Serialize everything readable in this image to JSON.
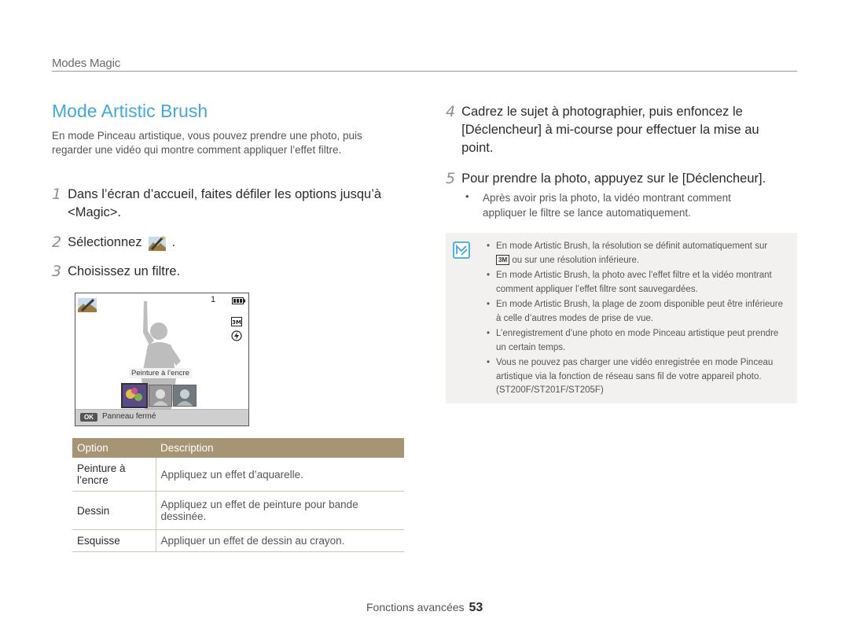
{
  "section": "Modes Magic",
  "title": "Mode Artistic Brush",
  "intro": "En mode Pinceau artistique, vous pouvez prendre une photo, puis regarder une vidéo qui montre comment appliquer l’effet filtre.",
  "steps_left": [
    {
      "num": "1",
      "text": "Dans l’écran d’accueil, faites défiler les options jusqu’à <Magic>."
    },
    {
      "num": "2",
      "text": "Sélectionnez",
      "suffix": "."
    },
    {
      "num": "3",
      "text": "Choisissez un filtre."
    }
  ],
  "screen": {
    "shot_count": "1",
    "filter_caption": "Peinture à l’encre",
    "ok_label": "OK",
    "panel_text": "Panneau fermé",
    "res_label": "3M"
  },
  "table": {
    "headers": [
      "Option",
      "Description"
    ],
    "rows": [
      {
        "option": "Peinture à l’encre",
        "desc": "Appliquez un effet d’aquarelle."
      },
      {
        "option": "Dessin",
        "desc": "Appliquez un effet de peinture pour bande dessinée."
      },
      {
        "option": "Esquisse",
        "desc": "Appliquer un effet de dessin au crayon."
      }
    ]
  },
  "steps_right": [
    {
      "num": "4",
      "pre": "Cadrez le sujet à photographier, puis enfoncez le [",
      "key": "Déclencheur",
      "post": "] à mi-course pour effectuer la mise au point."
    },
    {
      "num": "5",
      "pre": "Pour prendre la photo, appuyez sur le [",
      "key": "Déclencheur",
      "post": "]."
    }
  ],
  "sub_bullet": "Après avoir pris la photo, la vidéo montrant comment appliquer le filtre se lance automatiquement.",
  "note": {
    "items": [
      {
        "pre": "En mode Artistic Brush, la résolution se définit automatiquement sur",
        "icon": "3M",
        "post": "ou sur une résolution inférieure."
      },
      {
        "pre": "En mode Artistic Brush, la photo avec l’effet filtre et la vidéo montrant comment appliquer l’effet filtre sont sauvegardées."
      },
      {
        "pre": "En mode Artistic Brush, la plage de zoom disponible peut être inférieure à celle d’autres modes de prise de vue."
      },
      {
        "pre": "L’enregistrement d’une photo en mode Pinceau artistique peut prendre un certain temps."
      },
      {
        "pre": "Vous ne pouvez pas charger une vidéo enregistrée en mode Pinceau artistique via la fonction de réseau sans fil de votre appareil photo. (ST200F/ST201F/ST205F)"
      }
    ]
  },
  "footer": {
    "label": "Fonctions avancées",
    "page": "53"
  },
  "colors": {
    "title": "#3fa9e0",
    "table_header": "#a69575",
    "note_bg": "#f2f1ef"
  }
}
